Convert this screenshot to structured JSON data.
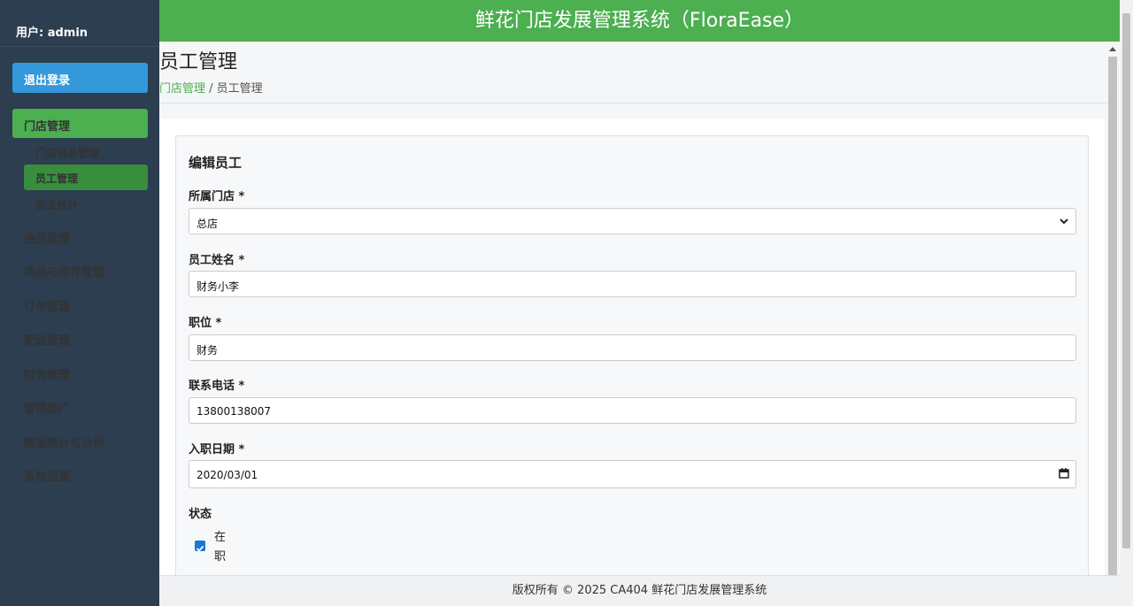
{
  "sidebar": {
    "user_label": "用户: admin",
    "logout_label": "退出登录",
    "active_section": "门店管理",
    "sub_items": [
      "门店信息管理",
      "员工管理",
      "营业统计"
    ],
    "items": [
      "会员管理",
      "商品与库存管理",
      "订单管理",
      "配送管理",
      "财务管理",
      "营销推广",
      "数据统计与分析",
      "系统设置"
    ]
  },
  "header": {
    "title": "鲜花门店发展管理系统（FloraEase）"
  },
  "page": {
    "title": "员工管理",
    "breadcrumb_link": "门店管理",
    "breadcrumb_sep": " / ",
    "breadcrumb_current": "员工管理"
  },
  "form": {
    "title": "编辑员工",
    "store_label": "所属门店 *",
    "store_value": "总店",
    "name_label": "员工姓名 *",
    "name_value": "财务小李",
    "position_label": "职位 *",
    "position_value": "财务",
    "phone_label": "联系电话 *",
    "phone_value": "13800138007",
    "date_label": "入职日期 *",
    "date_value": "2020/03/01",
    "status_label": "状态",
    "status_option": "在职",
    "status_checked": true
  },
  "footer": {
    "text": "版权所有 © 2025 CA404 鲜花门店发展管理系统"
  },
  "colors": {
    "accent": "#4caf50",
    "sidebar": "#2c3e50",
    "logout": "#3498db",
    "active_sub": "#388e3c"
  }
}
